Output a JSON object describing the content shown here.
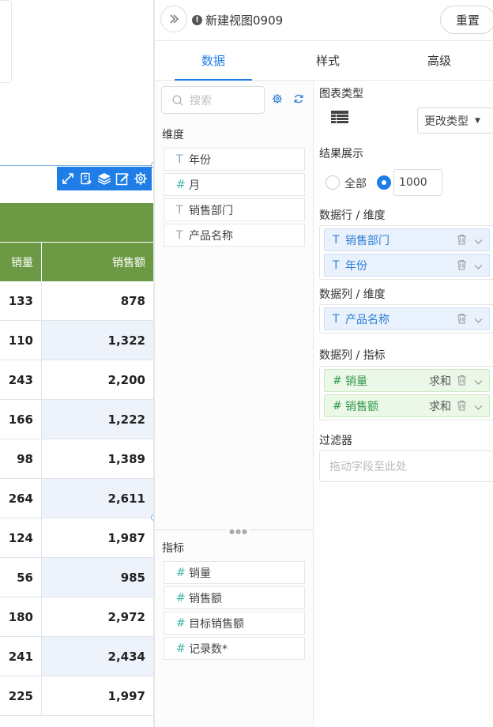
{
  "table": {
    "headers": [
      "销量",
      "销售额"
    ],
    "rows": [
      [
        "133",
        "878"
      ],
      [
        "110",
        "1,322"
      ],
      [
        "243",
        "2,200"
      ],
      [
        "166",
        "1,222"
      ],
      [
        "98",
        "1,389"
      ],
      [
        "264",
        "2,611"
      ],
      [
        "124",
        "1,987"
      ],
      [
        "56",
        "985"
      ],
      [
        "180",
        "2,972"
      ],
      [
        "241",
        "2,434"
      ],
      [
        "225",
        "1,997"
      ]
    ]
  },
  "toolbar": {
    "icons": [
      "expand-icon",
      "export-icon",
      "layers-icon",
      "edit-icon",
      "gear-icon"
    ]
  },
  "panel": {
    "view_title": "新建视图0909",
    "reset_label": "重置",
    "tabs": [
      "数据",
      "样式",
      "高级"
    ],
    "active_tab": "数据"
  },
  "fields": {
    "search_placeholder": "搜索",
    "dimensions_label": "维度",
    "dimensions": [
      {
        "type": "T",
        "name": "年份"
      },
      {
        "type": "#",
        "name": "月"
      },
      {
        "type": "T",
        "name": "销售部门"
      },
      {
        "type": "T",
        "name": "产品名称"
      }
    ],
    "measures_label": "指标",
    "measures": [
      {
        "type": "#",
        "name": "销量"
      },
      {
        "type": "#",
        "name": "销售额"
      },
      {
        "type": "#",
        "name": "目标销售额"
      },
      {
        "type": "#",
        "name": "记录数*"
      }
    ]
  },
  "config": {
    "chart_type_label": "图表类型",
    "change_type_label": "更改类型",
    "result_label": "结果展示",
    "option_all": "全部",
    "limit_value": "1000",
    "rows_label": "数据行 / 维度",
    "rows": [
      {
        "type": "T",
        "name": "销售部门"
      },
      {
        "type": "T",
        "name": "年份"
      }
    ],
    "cols_label": "数据列 / 维度",
    "cols": [
      {
        "type": "T",
        "name": "产品名称"
      }
    ],
    "metrics_label": "数据列 / 指标",
    "metrics": [
      {
        "type": "#",
        "name": "销量",
        "agg": "求和"
      },
      {
        "type": "#",
        "name": "销售额",
        "agg": "求和"
      }
    ],
    "filter_label": "过滤器",
    "filter_placeholder": "拖动字段至此处"
  },
  "colors": {
    "accent": "#1e7de6",
    "header_green": "#6c9a44",
    "dim_pill": "#e8f1fc",
    "measure_pill": "#ebf7e7"
  }
}
